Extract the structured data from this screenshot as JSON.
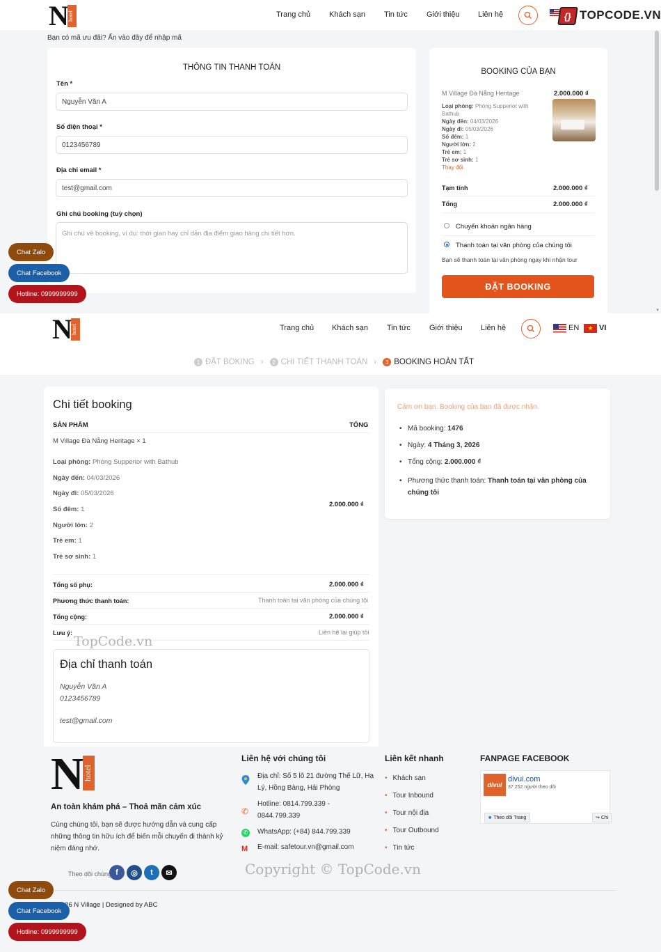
{
  "brand": {
    "logo_letter": "N",
    "logo_tag": "hotel"
  },
  "nav": [
    "Trang chủ",
    "Khách sạn",
    "Tin tức",
    "Giới thiệu",
    "Liên hệ"
  ],
  "topcode_logo": "TOPCODE.VN",
  "checkout": {
    "coupon_note": "Bạn có mã ưu đãi? Ấn vào đây để nhập mã",
    "form_title": "THÔNG TIN THANH TOÁN",
    "name_label": "Tên *",
    "name_value": "Nguyễn Văn A",
    "phone_label": "Số điện thoại *",
    "phone_value": "0123456789",
    "email_label": "Địa chỉ email *",
    "email_value": "test@gmail.com",
    "note_label": "Ghi chú booking (tuỳ chọn)",
    "note_placeholder": "Ghi chú về booking, ví dụ: thời gian hay chỉ dẫn địa điểm giao hàng chi tiết hơn."
  },
  "booking_card": {
    "title": "BOOKING CỦA BẠN",
    "hotel": "M Village Đà Nẵng Heritage",
    "price": "2.000.000 ₫",
    "room_type_label": "Loại phòng:",
    "room_type": "Phòng Supperior with Bathub",
    "checkin_label": "Ngày đến:",
    "checkin": "04/03/2026",
    "checkout_label": "Ngày đi:",
    "checkout": "05/03/2026",
    "nights_label": "Số đêm:",
    "nights": "1",
    "adults_label": "Người lớn:",
    "adults": "2",
    "children_label": "Trẻ em:",
    "children": "1",
    "infants_label": "Trẻ sơ sinh:",
    "infants": "1",
    "change_link": "Thay đổi",
    "subtotal_label": "Tạm tính",
    "subtotal": "2.000.000 ₫",
    "total_label": "Tổng",
    "total": "2.000.000 ₫",
    "pay_bank": "Chuyển khoản ngân hàng",
    "pay_office": "Thanh toán tại văn phòng của chúng tôi",
    "pay_office_desc": "Bạn sẽ thanh toán tại văn phòng ngay khi nhận tour",
    "submit": "ĐẶT BOOKING"
  },
  "floating": {
    "zalo": "Chat Zalo",
    "facebook": "Chat Facebook",
    "hotline": "Hotline: 0999999999"
  },
  "lang": {
    "en": "EN",
    "vi": "VI"
  },
  "steps": [
    {
      "num": "1",
      "label": "ĐẶT BOKING"
    },
    {
      "num": "2",
      "label": "CHI TIẾT THANH TOÁN"
    },
    {
      "num": "3",
      "label": "BOOKING HOÀN TẤT"
    }
  ],
  "detail": {
    "title": "Chi tiết booking",
    "col_product": "SẢN PHẨM",
    "col_total": "TỔNG",
    "product": "M Village Đà Nẵng Heritage × 1",
    "room_type_label": "Loại phòng:",
    "room_type": "Phòng Supperior with Bathub",
    "checkin_label": "Ngày đến:",
    "checkin": "04/03/2026",
    "checkout_label": "Ngày đi:",
    "checkout": "05/03/2026",
    "nights_label": "Số đêm:",
    "nights": "1",
    "adults_label": "Người lớn:",
    "adults": "2",
    "children_label": "Trẻ em:",
    "children": "1",
    "infants_label": "Trẻ sơ sinh:",
    "infants": "1",
    "line_total": "2.000.000 ₫",
    "subtotal_label": "Tổng số phụ:",
    "subtotal": "2.000.000 ₫",
    "method_label": "Phương thức thanh toán:",
    "method": "Thanh toán tại văn phòng của chúng tôi",
    "grand_label": "Tổng cộng:",
    "grand": "2.000.000 ₫",
    "note_label": "Lưu ý:",
    "note": "Liên hệ lại giúp tôi",
    "address_title": "Địa chỉ thanh toán",
    "addr_name": "Nguyễn Văn A",
    "addr_phone": "0123456789",
    "addr_email": "test@gmail.com"
  },
  "confirm": {
    "thanks": "Cảm ơn bạn. Booking của bạn đã được nhận.",
    "code_label": "Mã booking:",
    "code": "1476",
    "date_label": "Ngày:",
    "date": "4 Tháng 3, 2026",
    "total_label": "Tổng cộng:",
    "total": "2.000.000 ₫",
    "method_label": "Phương thức thanh toán:",
    "method": "Thanh toán tại văn phòng của chúng tôi"
  },
  "footer": {
    "slogan": "An toàn khám phá – Thoả mãn cảm xúc",
    "about": "Cùng chúng tôi, bạn sẽ được hướng dẫn và cung cấp những thông tin hữu ích để biến mỗi chuyến đi thành kỷ niệm đáng nhớ.",
    "follow": "Theo dõi chúng tôi",
    "contact_title": "Liên hệ với chúng tôi",
    "address": "Địa chỉ: Số 5 lô 21 đường Thế Lữ, Hạ Lý, Hồng Bàng, Hải Phòng",
    "hotline": "Hotline: 0814.799.339 - 0844.799.339",
    "whatsapp": "WhatsApp: (+84) 844.799.339",
    "email": "E-mail: safetour.vn@gmail.com",
    "links_title": "Liên kết nhanh",
    "links": [
      "Khách sạn",
      "Tour Inbound",
      "Tour nội địa",
      "Tour Outbound",
      "Tin tức"
    ],
    "fanpage_title": "FANPAGE FACEBOOK",
    "fb_logo": "divui",
    "fb_name": "divui.com",
    "fb_followers": "37 252 người theo dõi",
    "fb_follow": "Theo dõi Trang",
    "fb_share": "Chi",
    "copyright": "© 2026 N Village | Designed by ABC"
  },
  "watermarks": {
    "mid": "TopCode.vn",
    "bottom": "Copyright © TopCode.vn"
  }
}
